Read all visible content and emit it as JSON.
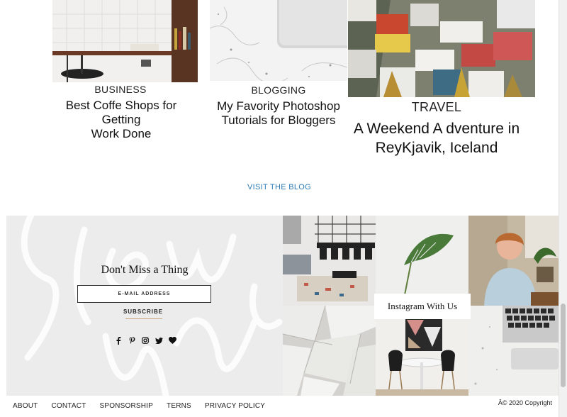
{
  "posts": [
    {
      "category": "BUSINESS",
      "title": "Best Coffe Shops for\nGetting\nWork Done"
    },
    {
      "category": "BLOGGING",
      "title": "My Favority Photoshop\nTutorials for Bloggers"
    },
    {
      "category": "TRAVEL",
      "title": "A Weekend A dventure in\nReyKjavik, Iceland"
    }
  ],
  "visit_blog": "VISIT THE BLOG",
  "signup": {
    "title": "Don't Miss a Thing",
    "email_placeholder": "E-MAIL ADDRESS",
    "subscribe": "SUBSCRIBE",
    "social_icons": [
      "facebook-icon",
      "pinterest-icon",
      "instagram-icon",
      "twitter-icon",
      "heart-icon"
    ]
  },
  "instagram": {
    "label": "Instagram With Us"
  },
  "footer": {
    "links": [
      "ABOUT",
      "CONTACT",
      "SPONSORSHIP",
      "TERNS",
      "PRIVACY POLICY"
    ],
    "copyright": "Â© 2020 Copyright"
  },
  "colors": {
    "link": "#2e7bb4",
    "panel": "#ececec",
    "accent_underline": "#c9a57c"
  }
}
